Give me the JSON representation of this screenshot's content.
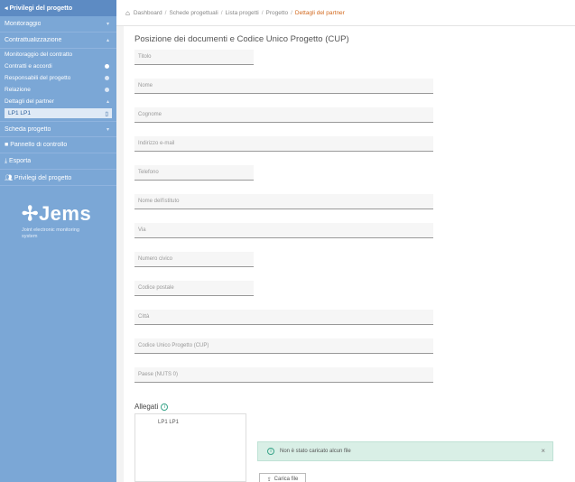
{
  "sidebar": {
    "top_link": "Privilegi del progetto",
    "monitoring": "Monitoraggio",
    "contracting": "Contrattualizzazione",
    "contract_monitoring": "Monitoraggio del contratto",
    "contracts_agreements": "Contratti e accordi",
    "project_managers": "Responsabili del progetto",
    "reporting": "Relazione",
    "partner_details": "Dettagli del partner",
    "active_partner": "LP1 LP1",
    "project_sheet": "Scheda progetto",
    "control_panel": "Pannello di controllo",
    "export": "Esporta",
    "project_privileges": "Privilegi del progetto",
    "logo_text": "Jems",
    "logo_tagline_1": "Joint electronic monitoring",
    "logo_tagline_2": "system"
  },
  "breadcrumb": {
    "items": [
      "Dashboard",
      "Schede progettuali",
      "Lista progetti",
      "Progetto"
    ],
    "current": "Dettagli del partner"
  },
  "form": {
    "title": "Posizione dei documenti e Codice Unico Progetto (CUP)",
    "fields": {
      "title": "Titolo",
      "first_name": "Nome",
      "last_name": "Cognome",
      "email": "Indirizzo e-mail",
      "phone": "Telefono",
      "institution": "Nome dell'istituto",
      "street": "Via",
      "house_number": "Numero civico",
      "postal_code": "Codice postale",
      "city": "Città",
      "cup_code": "Codice Unico Progetto (CUP)",
      "country": "Paese (NUTS 0)"
    }
  },
  "attachments": {
    "title": "Allegati",
    "tree_item": "LP1 LP1",
    "alert_text": "Non è stato caricato alcun file",
    "upload_label": "Carica file"
  }
}
